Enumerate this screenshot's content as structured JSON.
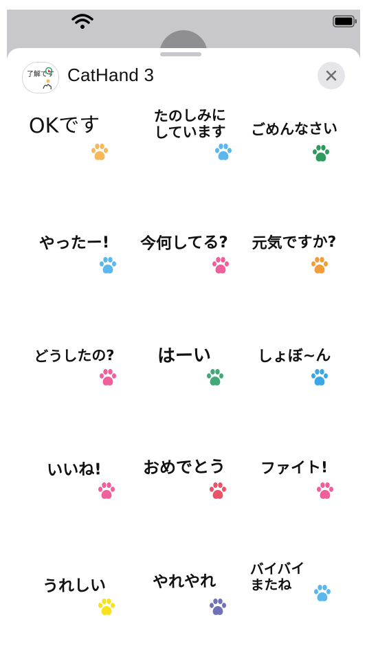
{
  "app": {
    "title": "CatHand 3",
    "icon": "app-icon",
    "icon_text": "了解です"
  },
  "background": {
    "dim_color": "#c8c8cc",
    "accent": "#3478f6"
  },
  "stickers": [
    {
      "text": "OKです",
      "paw_color": "#f5b85a"
    },
    {
      "text": "たのしみに\nしています",
      "paw_color": "#5bb7ee"
    },
    {
      "text": "ごめんなさい",
      "paw_color": "#2e9a5c"
    },
    {
      "text": "やったー!",
      "paw_color": "#5bb7ee"
    },
    {
      "text": "今何してる?",
      "paw_color": "#ee5f9b"
    },
    {
      "text": "元気ですか?",
      "paw_color": "#f29d38"
    },
    {
      "text": "どうしたの?",
      "paw_color": "#ee5f9b"
    },
    {
      "text": "はーい",
      "paw_color": "#43a877"
    },
    {
      "text": "しょぼ~ん",
      "paw_color": "#3ba6e6"
    },
    {
      "text": "いいね!",
      "paw_color": "#ee5f9b"
    },
    {
      "text": "おめでとう",
      "paw_color": "#e9536a"
    },
    {
      "text": "ファイト!",
      "paw_color": "#ee5f9b"
    },
    {
      "text": "うれしい",
      "paw_color": "#f7e21b"
    },
    {
      "text": "やれやれ",
      "paw_color": "#6f72b8"
    },
    {
      "text": "バイバイ\nまたね",
      "paw_color": "#5bb7ee"
    }
  ]
}
